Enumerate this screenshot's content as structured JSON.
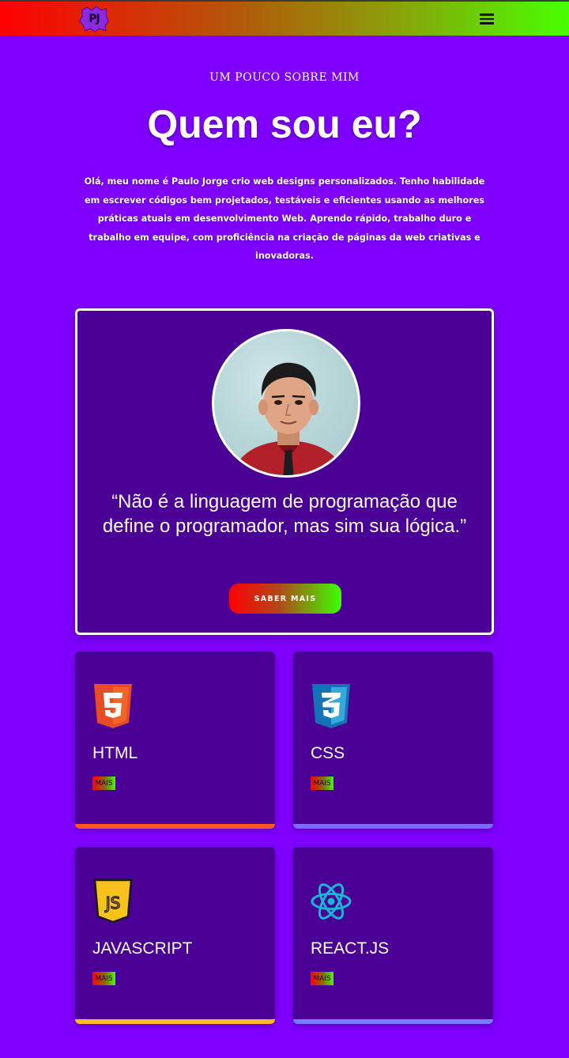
{
  "header": {
    "logo_text": "PJ",
    "menu_icon": "hamburger-menu-icon"
  },
  "about": {
    "eyebrow": "UM POUCO SOBRE MIM",
    "title": "Quem sou eu?",
    "intro": "Olá, meu nome é Paulo Jorge crio web designs personalizados. Tenho habilidade em escrever códigos bem projetados, testáveis e eficientes usando as melhores práticas atuais em desenvolvimento Web. Aprendo rápido, trabalho duro e trabalho em equipe, com proficiência na criação de páginas da web criativas e inovadoras."
  },
  "hero": {
    "quote": "“Não é a linguagem de programação que define o programador, mas sim sua lógica.”",
    "cta_label": "SABER MAIS"
  },
  "skills": [
    {
      "name": "HTML",
      "more": "MAIS",
      "icon": "html5-icon",
      "color": "#ff5722"
    },
    {
      "name": "CSS",
      "more": "MAIS",
      "icon": "css3-icon",
      "color": "#7a6cff"
    },
    {
      "name": "JAVASCRIPT",
      "more": "MAIS",
      "icon": "javascript-icon",
      "color": "#ffb82e"
    },
    {
      "name": "REACT.JS",
      "more": "MAIS",
      "icon": "react-icon",
      "color": "#7a7cff"
    }
  ],
  "colors": {
    "background": "#7f00ff",
    "card": "#4b0095",
    "gradient_start": "#ff0000",
    "gradient_end": "#47ff00"
  }
}
